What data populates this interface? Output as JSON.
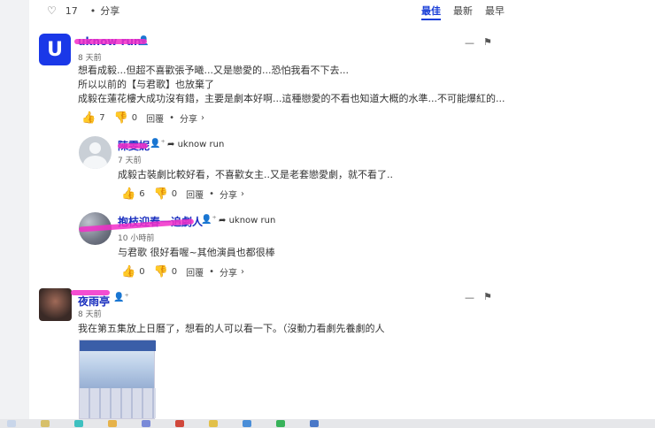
{
  "topbar": {
    "like_count": "17",
    "share_label": "分享"
  },
  "sort": {
    "best": "最佳",
    "newest": "最新",
    "oldest": "最早"
  },
  "comments": [
    {
      "user": "uknow run",
      "avatar_letter": "U",
      "time": "8 天前",
      "lines": [
        "想看成毅...但超不喜歡張予曦...又是戀愛的...恐怕我看不下去...",
        "所以以前的【与君歌】也放棄了",
        "成毅在蓮花樓大成功沒有錯，主要是劇本好啊...這種戀愛的不看也知道大概的水準...不可能爆紅的..."
      ],
      "likes": "7",
      "dislikes": "0",
      "reply_label": "回覆",
      "share_label": "分享"
    },
    {
      "user": "陳雯妮",
      "reply_to": "uknow run",
      "time": "7 天前",
      "lines": [
        "成毅古裝劇比較好看，不喜歡女主..又是老套戀愛劇，就不看了.."
      ],
      "likes": "6",
      "dislikes": "0",
      "reply_label": "回覆",
      "share_label": "分享"
    },
    {
      "user": "抱枝迎春一追劇人",
      "reply_to": "uknow run",
      "time": "10 小時前",
      "lines": [
        "与君歌 很好看喔~其他演員也都很棒"
      ],
      "likes": "0",
      "dislikes": "0",
      "reply_label": "回覆",
      "share_label": "分享"
    },
    {
      "user": "夜雨亭",
      "time": "8 天前",
      "lines": [
        "我在第五集放上日曆了，想看的人可以看一下。（沒動力看劇先養劇的人"
      ]
    }
  ]
}
